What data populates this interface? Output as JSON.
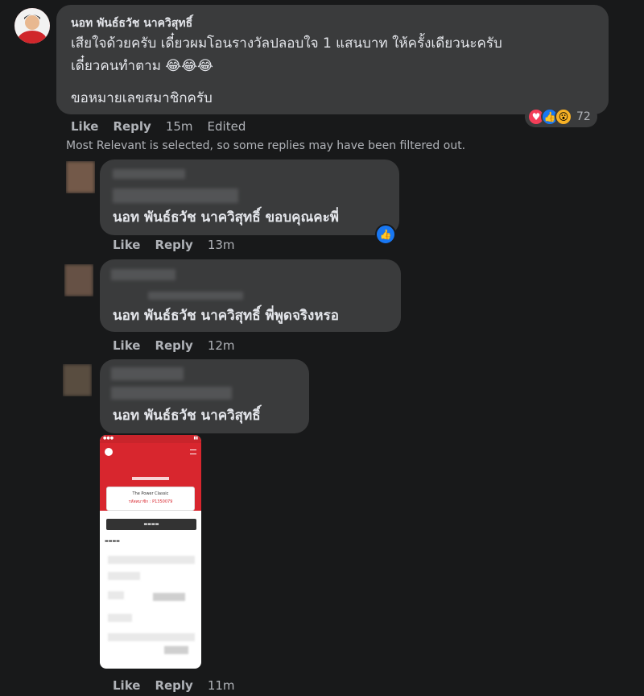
{
  "main_comment": {
    "author": "นอท พันธ์ธวัช นาควิสุทธิ์",
    "line1": "เสียใจด้วยครับ เดี๋ยวผมโอนรางวัลปลอบใจ 1 แสนบาท ให้ครั้งเดียวนะครับ",
    "line2": "เดี๋ยวคนทำตาม 😂😂😂",
    "line3": "ขอหมายเลขสมาชิกครับ",
    "like": "Like",
    "reply": "Reply",
    "time": "15m",
    "edited": "Edited",
    "reaction_count": "72"
  },
  "filter_note": "Most Relevant is selected, so some replies may have been filtered out.",
  "replies": [
    {
      "mention": "นอท พันธ์ธวัช นาควิสุทธิ์",
      "text": " ขอบคุณคะพี่",
      "like": "Like",
      "reply": "Reply",
      "time": "13m"
    },
    {
      "mention": "นอท พันธ์ธวัช นาควิสุทธิ์",
      "text": " พี่พูดจริงหรอ",
      "like": "Like",
      "reply": "Reply",
      "time": "12m"
    },
    {
      "mention": "นอท พันธ์ธวัช นาควิสุทธิ์",
      "text": "",
      "like": "Like",
      "reply": "Reply",
      "time": "11m"
    }
  ],
  "attachment": {
    "card_title": "The Power Classic",
    "card_sub": "รหัสสมาชิก : P1350079"
  },
  "colors": {
    "bg": "#18191a",
    "bubble": "#3a3b3c",
    "like_blue": "#1877f2",
    "love_red": "#f33e58"
  }
}
